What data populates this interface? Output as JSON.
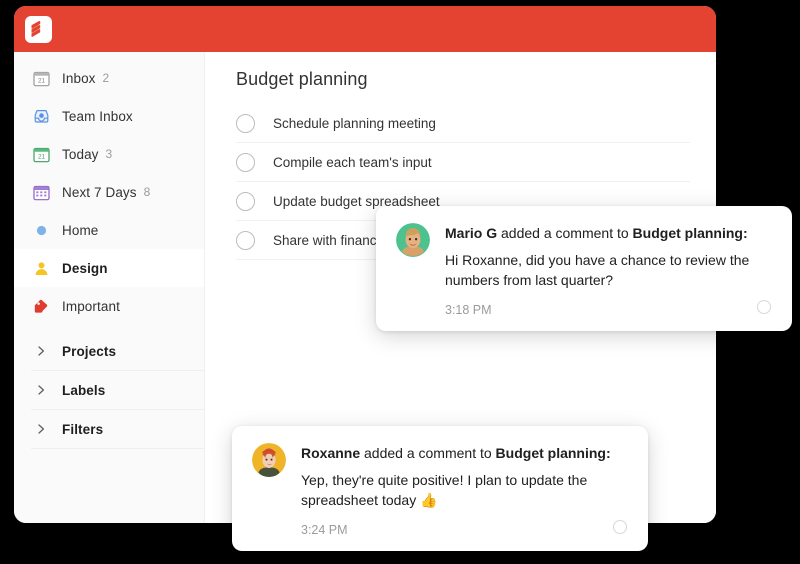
{
  "window": {
    "brand_color": "#e44332",
    "logo_icon": "todoist-logo-icon"
  },
  "sidebar": {
    "items": [
      {
        "label": "Inbox",
        "count": "2",
        "icon": "calendar-21-gray-icon",
        "type": "nav",
        "selected": false
      },
      {
        "label": "Team Inbox",
        "count": "",
        "icon": "team-inbox-tray-icon",
        "type": "nav",
        "selected": false
      },
      {
        "label": "Today",
        "count": "3",
        "icon": "calendar-21-green-icon",
        "type": "nav",
        "selected": false
      },
      {
        "label": "Next 7 Days",
        "count": "8",
        "icon": "calendar-grid-purple-icon",
        "type": "nav",
        "selected": false
      },
      {
        "label": "Home",
        "count": "",
        "icon": "blue-dot-icon",
        "type": "nav",
        "selected": false
      },
      {
        "label": "Design",
        "count": "",
        "icon": "yellow-person-icon",
        "type": "nav",
        "selected": true
      },
      {
        "label": "Important",
        "count": "",
        "icon": "red-tag-icon",
        "type": "nav",
        "selected": false
      },
      {
        "label": "Projects",
        "count": "",
        "icon": "chevron-right-icon",
        "type": "group",
        "selected": false
      },
      {
        "label": "Labels",
        "count": "",
        "icon": "chevron-right-icon",
        "type": "group",
        "selected": false
      },
      {
        "label": "Filters",
        "count": "",
        "icon": "chevron-right-icon",
        "type": "group",
        "selected": false
      }
    ]
  },
  "main": {
    "project_title": "Budget planning",
    "tasks": [
      {
        "text": "Schedule planning meeting"
      },
      {
        "text": "Compile each team's input"
      },
      {
        "text": "Update budget spreadsheet"
      },
      {
        "text": "Share with finance team"
      }
    ]
  },
  "notifications": [
    {
      "actor": "Mario G",
      "action": " added a comment to ",
      "target": "Budget planning:",
      "message": "Hi Roxanne, did you have a chance to review the numbers from last quarter?",
      "time": "3:18 PM",
      "avatar": "mario-avatar",
      "avatar_bg": "#4ec28e",
      "unread": true
    },
    {
      "actor": "Roxanne",
      "action": " added a comment to ",
      "target": "Budget planning:",
      "message": "Yep, they're quite positive! I plan to update the spreadsheet today 👍",
      "time": "3:24 PM",
      "avatar": "roxanne-avatar",
      "avatar_bg": "#f0b429",
      "unread": true
    }
  ]
}
